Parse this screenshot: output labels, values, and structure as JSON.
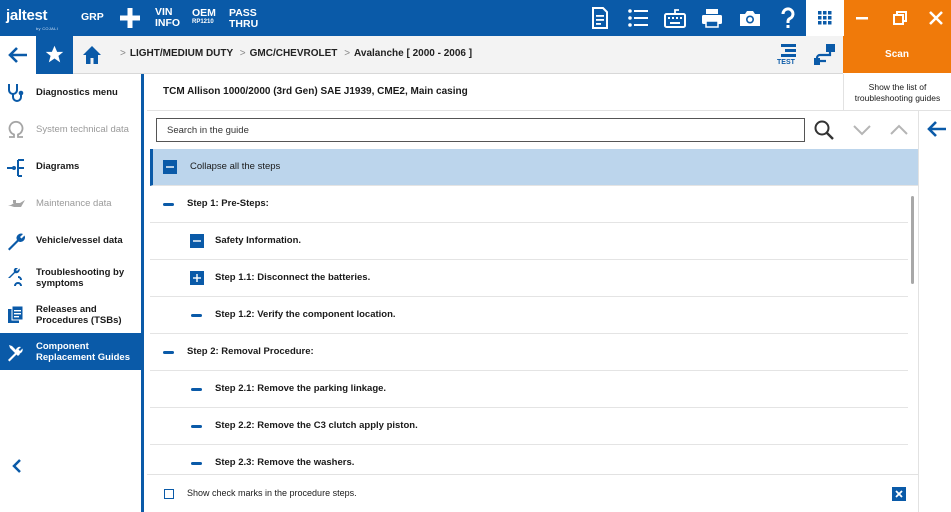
{
  "topbar": {
    "logo_text": "jaltest",
    "logo_sub": "by COJALI",
    "grp_label": "GRP",
    "vin_line1": "VIN",
    "vin_line2": "INFO",
    "oem_line1": "OEM",
    "oem_line2": "RP1210",
    "pass_line1": "PASS",
    "pass_line2": "THRU",
    "icons": [
      "report-icon",
      "list-icon",
      "keyboard-icon",
      "printer-icon",
      "camera-icon",
      "help-icon",
      "apps-grid-icon",
      "minimize-icon",
      "restore-icon",
      "close-icon"
    ]
  },
  "navbar": {
    "breadcrumb": [
      "LIGHT/MEDIUM DUTY",
      "GMC/CHEVROLET",
      "Avalanche [ 2000 - 2006 ]"
    ],
    "test_icon_label": "TEST",
    "scan_label": "Scan"
  },
  "sidebar": {
    "items": [
      {
        "label": "Diagnostics menu",
        "icon": "stethoscope-icon",
        "state": "normal"
      },
      {
        "label": "System technical data",
        "icon": "omega-icon",
        "state": "disabled"
      },
      {
        "label": "Diagrams",
        "icon": "diagram-icon",
        "state": "normal"
      },
      {
        "label": "Maintenance data",
        "icon": "oil-can-icon",
        "state": "disabled"
      },
      {
        "label": "Vehicle/vessel data",
        "icon": "wrench-icon",
        "state": "normal"
      },
      {
        "label": "Troubleshooting by symptoms",
        "icon": "troubleshoot-icon",
        "state": "normal"
      },
      {
        "label": "Releases and Procedures (TSBs)",
        "icon": "documents-icon",
        "state": "normal"
      },
      {
        "label": "Component Replacement Guides",
        "icon": "tools-icon",
        "state": "active"
      }
    ]
  },
  "main": {
    "title": "TCM Allison 1000/2000 (3rd Gen) SAE J1939, CME2, Main casing",
    "troubleshooting_help": "Show the list of troubleshooting guides",
    "search_placeholder": "Search in the guide",
    "collapse_all": "Collapse all the steps",
    "steps": [
      {
        "label": "Step 1: Pre-Steps:",
        "level": 0,
        "mark": "dash"
      },
      {
        "label": "Safety Information.",
        "level": 1,
        "mark": "box-minus"
      },
      {
        "label": "Step 1.1: Disconnect the batteries.",
        "level": 1,
        "mark": "box-plus"
      },
      {
        "label": "Step 1.2: Verify the component location.",
        "level": 1,
        "mark": "dash"
      },
      {
        "label": "Step 2: Removal Procedure:",
        "level": 0,
        "mark": "dash"
      },
      {
        "label": "Step 2.1: Remove the parking linkage.",
        "level": 1,
        "mark": "dash"
      },
      {
        "label": "Step 2.2: Remove the C3 clutch apply piston.",
        "level": 1,
        "mark": "dash"
      },
      {
        "label": "Step 2.3: Remove the washers.",
        "level": 1,
        "mark": "dash"
      }
    ],
    "footer_checkbox": "Show check marks in the procedure steps."
  },
  "colors": {
    "primary": "#0a5aa8",
    "accent": "#f07a0a",
    "highlight": "#bcd5ec"
  }
}
